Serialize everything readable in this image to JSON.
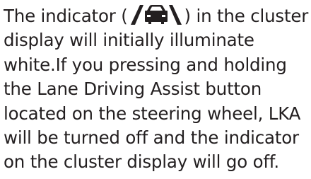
{
  "paragraph": {
    "line_1_before_icon": "The indicator (",
    "line_1_after_icon": ") in the cluster",
    "line_2": "display will initially illuminate",
    "line_3": "white.If you pressing and holding",
    "line_4": "the Lane Driving Assist button",
    "line_5": "located on the steering wheel, LKA",
    "line_6": "will be turned off and the indicator",
    "line_7": "on the cluster display will go off."
  },
  "icon": {
    "name": "lane-keeping-assist-indicator-icon",
    "color": "#231f20"
  }
}
